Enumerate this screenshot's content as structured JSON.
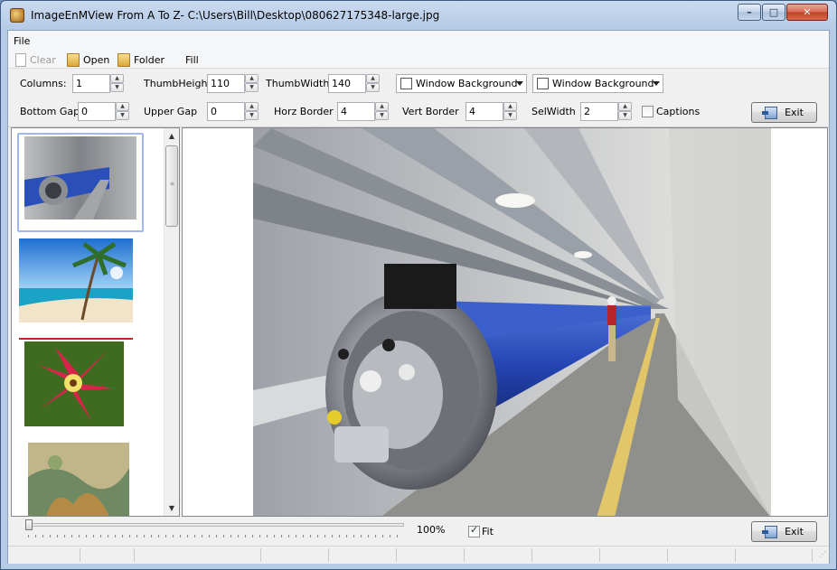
{
  "window": {
    "title": "ImageEnMView From A To Z- C:\\Users\\Bill\\Desktop\\080627175348-large.jpg",
    "controls": {
      "minimize": "–",
      "maximize": "□",
      "close": "✕"
    }
  },
  "menu": {
    "file": "File"
  },
  "toolbar": {
    "clear": "Clear",
    "open": "Open",
    "folder": "Folder",
    "fill": "Fill"
  },
  "settings": {
    "columns_label": "Columns:",
    "columns_value": "1",
    "thumb_height_label": "ThumbHeight",
    "thumb_height_value": "110",
    "thumb_width_label": "ThumbWidth",
    "thumb_width_value": "140",
    "bg_combo_1": "Window Background",
    "bg_combo_2": "Window Background",
    "bottom_gap_label": "Bottom Gap",
    "bottom_gap_value": "0",
    "upper_gap_label": "Upper Gap",
    "upper_gap_value": "0",
    "horz_border_label": "Horz Border",
    "horz_border_value": "4",
    "vert_border_label": "Vert Border",
    "vert_border_value": "4",
    "sel_width_label": "SelWidth",
    "sel_width_value": "2",
    "captions_label": "Captions",
    "captions_checked": false,
    "exit_label": "Exit"
  },
  "thumbnails": [
    {
      "name": "lhc-tunnel",
      "selected": true
    },
    {
      "name": "tropical-beach",
      "selected": false
    },
    {
      "name": "red-lily",
      "selected": false
    },
    {
      "name": "painting",
      "selected": false
    }
  ],
  "zoom": {
    "percent": "100%",
    "fit_label": "Fit",
    "fit_checked": true,
    "slider_value": 0
  },
  "bottom_exit_label": "Exit",
  "colors": {
    "accent": "#a2b6ef",
    "frame": "#b6cbe6"
  }
}
